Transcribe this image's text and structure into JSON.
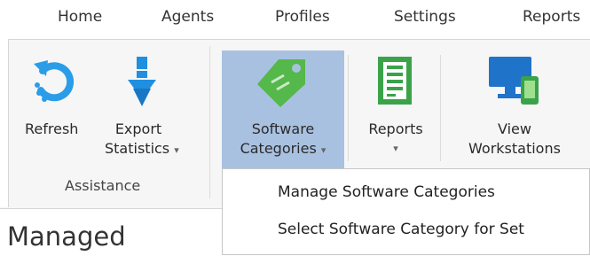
{
  "tabs": [
    {
      "label": "Home"
    },
    {
      "label": "Agents"
    },
    {
      "label": "Profiles"
    },
    {
      "label": "Settings"
    },
    {
      "label": "Reports"
    }
  ],
  "ribbon": {
    "refresh": {
      "label": "Refresh",
      "icon": "refresh-icon"
    },
    "export": {
      "line1": "Export",
      "line2": "Statistics",
      "icon": "download-arrow-icon"
    },
    "software": {
      "line1": "Software",
      "line2": "Categories",
      "icon": "tag-icon"
    },
    "reports": {
      "line1": "Reports",
      "icon": "report-document-icon"
    },
    "workstations": {
      "line1": "View",
      "line2": "Workstations",
      "icon": "monitor-icon"
    },
    "group_assistance": "Assistance",
    "dropdown_caret": "▾"
  },
  "dropdown": {
    "items": [
      {
        "label": "Manage Software Categories"
      },
      {
        "label": "Select Software Category for Set"
      }
    ]
  },
  "page": {
    "heading": "Managed"
  },
  "colors": {
    "highlight": "#a9c1e1",
    "refresh_blue": "#2b9de8",
    "export_blue": "#1f8fe0",
    "tag_green": "#55b84a",
    "report_green": "#3aa34a",
    "monitor_blue": "#1f73c9"
  }
}
